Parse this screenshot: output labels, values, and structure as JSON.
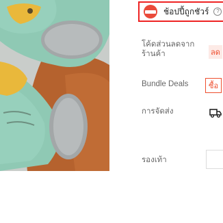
{
  "product": {
    "image_alt": "green slippers with yellow fish on orange leather background"
  },
  "guarantee": {
    "text": "ช้อปปี้ถูกชัวร์",
    "help_icon": "?"
  },
  "details": {
    "voucher_label": "โค้ดส่วนลดจากร้านค้า",
    "voucher_value": "ลด ",
    "bundle_label": "Bundle Deals",
    "bundle_value": "ซื้อ ",
    "shipping_label": "การจัดส่ง",
    "shipping_icon": "truck-icon",
    "shoe_label": "รองเท้า"
  },
  "colors": {
    "accent": "#ee4d2d",
    "guarantee_border": "#ee2222"
  }
}
